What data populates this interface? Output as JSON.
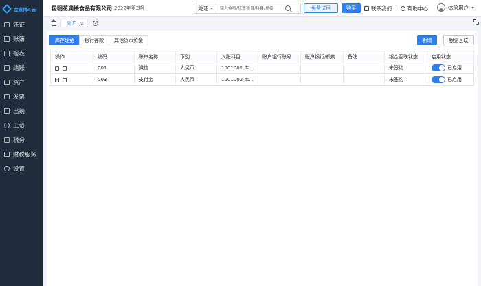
{
  "app": {
    "logo_text": "金蝶精斗云"
  },
  "sidebar": {
    "items": [
      {
        "label": "凭证",
        "icon": "voucher-icon"
      },
      {
        "label": "账簿",
        "icon": "ledger-icon"
      },
      {
        "label": "报表",
        "icon": "report-icon"
      },
      {
        "label": "结账",
        "icon": "closing-icon"
      },
      {
        "label": "资产",
        "icon": "asset-icon"
      },
      {
        "label": "发票",
        "icon": "invoice-icon"
      },
      {
        "label": "出纳",
        "icon": "cashier-icon"
      },
      {
        "label": "工资",
        "icon": "salary-icon"
      },
      {
        "label": "税务",
        "icon": "tax-icon"
      },
      {
        "label": "财税服务",
        "icon": "service-icon"
      },
      {
        "label": "设置",
        "icon": "settings-icon"
      }
    ]
  },
  "header": {
    "company": "昆明花满楼食品有限公司",
    "period": "2022年第2期",
    "search_type": "凭证",
    "search_placeholder": "输入金额/核算项目/科目/摘要",
    "trial_label": "免费试用",
    "buy_label": "购买",
    "contact_label": "联系我们",
    "help_label": "帮助中心",
    "user_label": "体验用户"
  },
  "tabs": {
    "current": "账户"
  },
  "content": {
    "tabs": [
      "库存现金",
      "银行存款",
      "其他货币资金"
    ],
    "new_label": "新增",
    "bank_label": "银企互联"
  },
  "table": {
    "columns": [
      "操作",
      "编码",
      "账户名称",
      "币别",
      "入账科目",
      "账户银行账号",
      "账户银行/机构",
      "备注",
      "银企互联状态",
      "启用状态"
    ],
    "rows": [
      {
        "code": "001",
        "name": "微信",
        "currency": "人民币",
        "subject": "1001001 库...",
        "account_no": "",
        "bank": "",
        "remark": "",
        "link_status": "未签约",
        "enabled": "已启用"
      },
      {
        "code": "003",
        "name": "支付宝",
        "currency": "人民币",
        "subject": "1001002 库...",
        "account_no": "",
        "bank": "",
        "remark": "",
        "link_status": "未签约",
        "enabled": "已启用"
      }
    ]
  },
  "colors": {
    "primary": "#2f80ed",
    "sidebar_bg": "#1f2d3d"
  }
}
